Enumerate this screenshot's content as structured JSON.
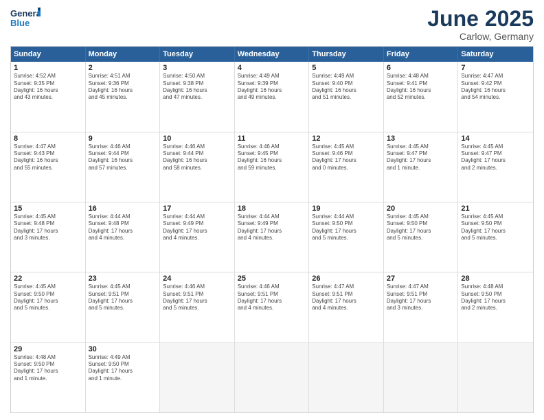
{
  "header": {
    "logo_general": "General",
    "logo_blue": "Blue",
    "month": "June 2025",
    "location": "Carlow, Germany"
  },
  "days_of_week": [
    "Sunday",
    "Monday",
    "Tuesday",
    "Wednesday",
    "Thursday",
    "Friday",
    "Saturday"
  ],
  "weeks": [
    [
      {
        "day": "1",
        "lines": [
          "Sunrise: 4:52 AM",
          "Sunset: 9:35 PM",
          "Daylight: 16 hours",
          "and 43 minutes."
        ]
      },
      {
        "day": "2",
        "lines": [
          "Sunrise: 4:51 AM",
          "Sunset: 9:36 PM",
          "Daylight: 16 hours",
          "and 45 minutes."
        ]
      },
      {
        "day": "3",
        "lines": [
          "Sunrise: 4:50 AM",
          "Sunset: 9:38 PM",
          "Daylight: 16 hours",
          "and 47 minutes."
        ]
      },
      {
        "day": "4",
        "lines": [
          "Sunrise: 4:49 AM",
          "Sunset: 9:39 PM",
          "Daylight: 16 hours",
          "and 49 minutes."
        ]
      },
      {
        "day": "5",
        "lines": [
          "Sunrise: 4:49 AM",
          "Sunset: 9:40 PM",
          "Daylight: 16 hours",
          "and 51 minutes."
        ]
      },
      {
        "day": "6",
        "lines": [
          "Sunrise: 4:48 AM",
          "Sunset: 9:41 PM",
          "Daylight: 16 hours",
          "and 52 minutes."
        ]
      },
      {
        "day": "7",
        "lines": [
          "Sunrise: 4:47 AM",
          "Sunset: 9:42 PM",
          "Daylight: 16 hours",
          "and 54 minutes."
        ]
      }
    ],
    [
      {
        "day": "8",
        "lines": [
          "Sunrise: 4:47 AM",
          "Sunset: 9:43 PM",
          "Daylight: 16 hours",
          "and 55 minutes."
        ]
      },
      {
        "day": "9",
        "lines": [
          "Sunrise: 4:46 AM",
          "Sunset: 9:44 PM",
          "Daylight: 16 hours",
          "and 57 minutes."
        ]
      },
      {
        "day": "10",
        "lines": [
          "Sunrise: 4:46 AM",
          "Sunset: 9:44 PM",
          "Daylight: 16 hours",
          "and 58 minutes."
        ]
      },
      {
        "day": "11",
        "lines": [
          "Sunrise: 4:46 AM",
          "Sunset: 9:45 PM",
          "Daylight: 16 hours",
          "and 59 minutes."
        ]
      },
      {
        "day": "12",
        "lines": [
          "Sunrise: 4:45 AM",
          "Sunset: 9:46 PM",
          "Daylight: 17 hours",
          "and 0 minutes."
        ]
      },
      {
        "day": "13",
        "lines": [
          "Sunrise: 4:45 AM",
          "Sunset: 9:47 PM",
          "Daylight: 17 hours",
          "and 1 minute."
        ]
      },
      {
        "day": "14",
        "lines": [
          "Sunrise: 4:45 AM",
          "Sunset: 9:47 PM",
          "Daylight: 17 hours",
          "and 2 minutes."
        ]
      }
    ],
    [
      {
        "day": "15",
        "lines": [
          "Sunrise: 4:45 AM",
          "Sunset: 9:48 PM",
          "Daylight: 17 hours",
          "and 3 minutes."
        ]
      },
      {
        "day": "16",
        "lines": [
          "Sunrise: 4:44 AM",
          "Sunset: 9:48 PM",
          "Daylight: 17 hours",
          "and 4 minutes."
        ]
      },
      {
        "day": "17",
        "lines": [
          "Sunrise: 4:44 AM",
          "Sunset: 9:49 PM",
          "Daylight: 17 hours",
          "and 4 minutes."
        ]
      },
      {
        "day": "18",
        "lines": [
          "Sunrise: 4:44 AM",
          "Sunset: 9:49 PM",
          "Daylight: 17 hours",
          "and 4 minutes."
        ]
      },
      {
        "day": "19",
        "lines": [
          "Sunrise: 4:44 AM",
          "Sunset: 9:50 PM",
          "Daylight: 17 hours",
          "and 5 minutes."
        ]
      },
      {
        "day": "20",
        "lines": [
          "Sunrise: 4:45 AM",
          "Sunset: 9:50 PM",
          "Daylight: 17 hours",
          "and 5 minutes."
        ]
      },
      {
        "day": "21",
        "lines": [
          "Sunrise: 4:45 AM",
          "Sunset: 9:50 PM",
          "Daylight: 17 hours",
          "and 5 minutes."
        ]
      }
    ],
    [
      {
        "day": "22",
        "lines": [
          "Sunrise: 4:45 AM",
          "Sunset: 9:50 PM",
          "Daylight: 17 hours",
          "and 5 minutes."
        ]
      },
      {
        "day": "23",
        "lines": [
          "Sunrise: 4:45 AM",
          "Sunset: 9:51 PM",
          "Daylight: 17 hours",
          "and 5 minutes."
        ]
      },
      {
        "day": "24",
        "lines": [
          "Sunrise: 4:46 AM",
          "Sunset: 9:51 PM",
          "Daylight: 17 hours",
          "and 5 minutes."
        ]
      },
      {
        "day": "25",
        "lines": [
          "Sunrise: 4:46 AM",
          "Sunset: 9:51 PM",
          "Daylight: 17 hours",
          "and 4 minutes."
        ]
      },
      {
        "day": "26",
        "lines": [
          "Sunrise: 4:47 AM",
          "Sunset: 9:51 PM",
          "Daylight: 17 hours",
          "and 4 minutes."
        ]
      },
      {
        "day": "27",
        "lines": [
          "Sunrise: 4:47 AM",
          "Sunset: 9:51 PM",
          "Daylight: 17 hours",
          "and 3 minutes."
        ]
      },
      {
        "day": "28",
        "lines": [
          "Sunrise: 4:48 AM",
          "Sunset: 9:50 PM",
          "Daylight: 17 hours",
          "and 2 minutes."
        ]
      }
    ],
    [
      {
        "day": "29",
        "lines": [
          "Sunrise: 4:48 AM",
          "Sunset: 9:50 PM",
          "Daylight: 17 hours",
          "and 1 minute."
        ]
      },
      {
        "day": "30",
        "lines": [
          "Sunrise: 4:49 AM",
          "Sunset: 9:50 PM",
          "Daylight: 17 hours",
          "and 1 minute."
        ]
      },
      {
        "day": "",
        "lines": []
      },
      {
        "day": "",
        "lines": []
      },
      {
        "day": "",
        "lines": []
      },
      {
        "day": "",
        "lines": []
      },
      {
        "day": "",
        "lines": []
      }
    ]
  ]
}
